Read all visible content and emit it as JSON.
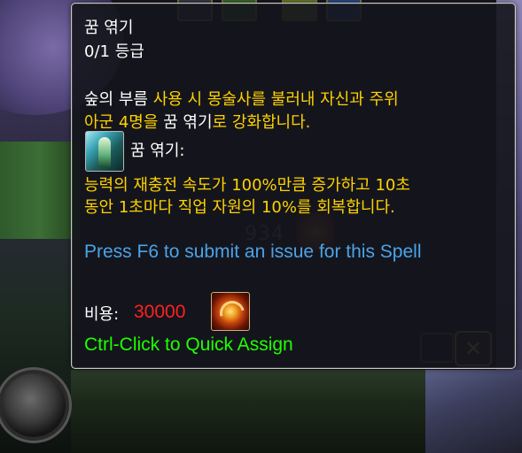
{
  "tooltip": {
    "title": "꿈 엮기",
    "rank": "0/1 등급",
    "desc_line1_white": "숲의 부름",
    "desc_line1_gold": " 사용 시 몽술사를 불러내 자신과 주위",
    "desc_line2_gold_a": "아군 4명을 ",
    "desc_line2_white": "꿈 엮기",
    "desc_line2_gold_b": "로 강화합니다.",
    "effect_name": "꿈 엮기:",
    "effect_line1": "능력의 재충전 속도가 100%만큼 증가하고 10초",
    "effect_line2": "동안 1초마다 직업 자원의 10%를 회복합니다.",
    "report_text": "Press F6 to submit an issue for this Spell",
    "cost_label": "비용:",
    "cost_value": "30000",
    "quick_assign": "Ctrl-Click to Quick Assign"
  },
  "background": {
    "partial_number": "934",
    "cancel_glyph": "✕"
  },
  "icons": {
    "spell": "dreamweaver-spell-icon",
    "cost": "fire-swirl-currency-icon",
    "cancel": "close-icon"
  },
  "colors": {
    "text_white": "#ffffff",
    "text_gold": "#ffd200",
    "text_blue": "#4aa3e8",
    "text_red": "#ff2020",
    "text_green": "#1eff00"
  }
}
